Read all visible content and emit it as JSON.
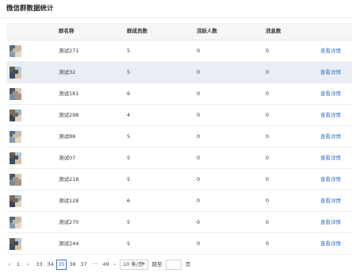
{
  "page": {
    "title": "微信群数据统计"
  },
  "table": {
    "headers": [
      "群名称",
      "群成员数",
      "活跃人数",
      "消息数"
    ],
    "action_label": "查看详情",
    "rows": [
      {
        "name": "测试271",
        "members": "5",
        "active": "0",
        "messages": "0"
      },
      {
        "name": "测试32",
        "members": "5",
        "active": "0",
        "messages": "0",
        "highlighted": true
      },
      {
        "name": "测试181",
        "members": "6",
        "active": "0",
        "messages": "0"
      },
      {
        "name": "测试298",
        "members": "4",
        "active": "0",
        "messages": "0"
      },
      {
        "name": "测试88",
        "members": "5",
        "active": "0",
        "messages": "0"
      },
      {
        "name": "测试07",
        "members": "5",
        "active": "0",
        "messages": "0"
      },
      {
        "name": "测试218",
        "members": "5",
        "active": "0",
        "messages": "0"
      },
      {
        "name": "测试128",
        "members": "6",
        "active": "0",
        "messages": "0"
      },
      {
        "name": "测试270",
        "members": "5",
        "active": "0",
        "messages": "0"
      },
      {
        "name": "测试244",
        "members": "5",
        "active": "0",
        "messages": "0"
      }
    ]
  },
  "pagination": {
    "prev_icon": "‹",
    "first": "1",
    "jump_back_icon": "«",
    "pages": [
      "33",
      "34",
      "35",
      "36",
      "37"
    ],
    "current": "35",
    "ellipsis": "•••",
    "last": "49",
    "next_icon": "›",
    "page_size": "10 条/页",
    "jump_label": "跳至",
    "jump_value": "",
    "page_unit": "页"
  },
  "colors": {
    "link": "#3b74c4",
    "highlight_row": "#e9eef5",
    "header_bg": "#f5f6f8"
  }
}
